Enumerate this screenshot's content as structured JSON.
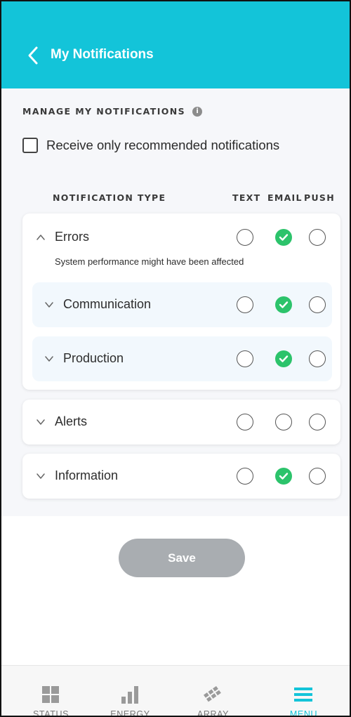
{
  "header": {
    "title": "My Notifications"
  },
  "manage": {
    "title": "MANAGE MY NOTIFICATIONS",
    "recommended_label": "Receive only recommended notifications",
    "recommended_checked": false
  },
  "table": {
    "columns": {
      "type": "NOTIFICATION TYPE",
      "text": "TEXT",
      "email": "EMAIL",
      "push": "PUSH"
    },
    "errors": {
      "label": "Errors",
      "description": "System performance might have been affected",
      "expanded": true,
      "selected": {
        "text": false,
        "email": true,
        "push": false
      },
      "children": [
        {
          "label": "Communication",
          "selected": {
            "text": false,
            "email": true,
            "push": false
          }
        },
        {
          "label": "Production",
          "selected": {
            "text": false,
            "email": true,
            "push": false
          }
        }
      ]
    },
    "alerts": {
      "label": "Alerts",
      "selected": {
        "text": false,
        "email": false,
        "push": false
      }
    },
    "information": {
      "label": "Information",
      "selected": {
        "text": false,
        "email": true,
        "push": false
      }
    }
  },
  "save_label": "Save",
  "tabs": [
    {
      "label": "STATUS",
      "icon": "grid-icon"
    },
    {
      "label": "ENERGY",
      "icon": "bar-chart-icon"
    },
    {
      "label": "ARRAY",
      "icon": "solar-array-icon"
    },
    {
      "label": "MENU",
      "icon": "menu-icon",
      "active": true
    }
  ],
  "colors": {
    "accent": "#13c4d9",
    "selected": "#2cc36b",
    "button_disabled": "#a9adb1"
  }
}
